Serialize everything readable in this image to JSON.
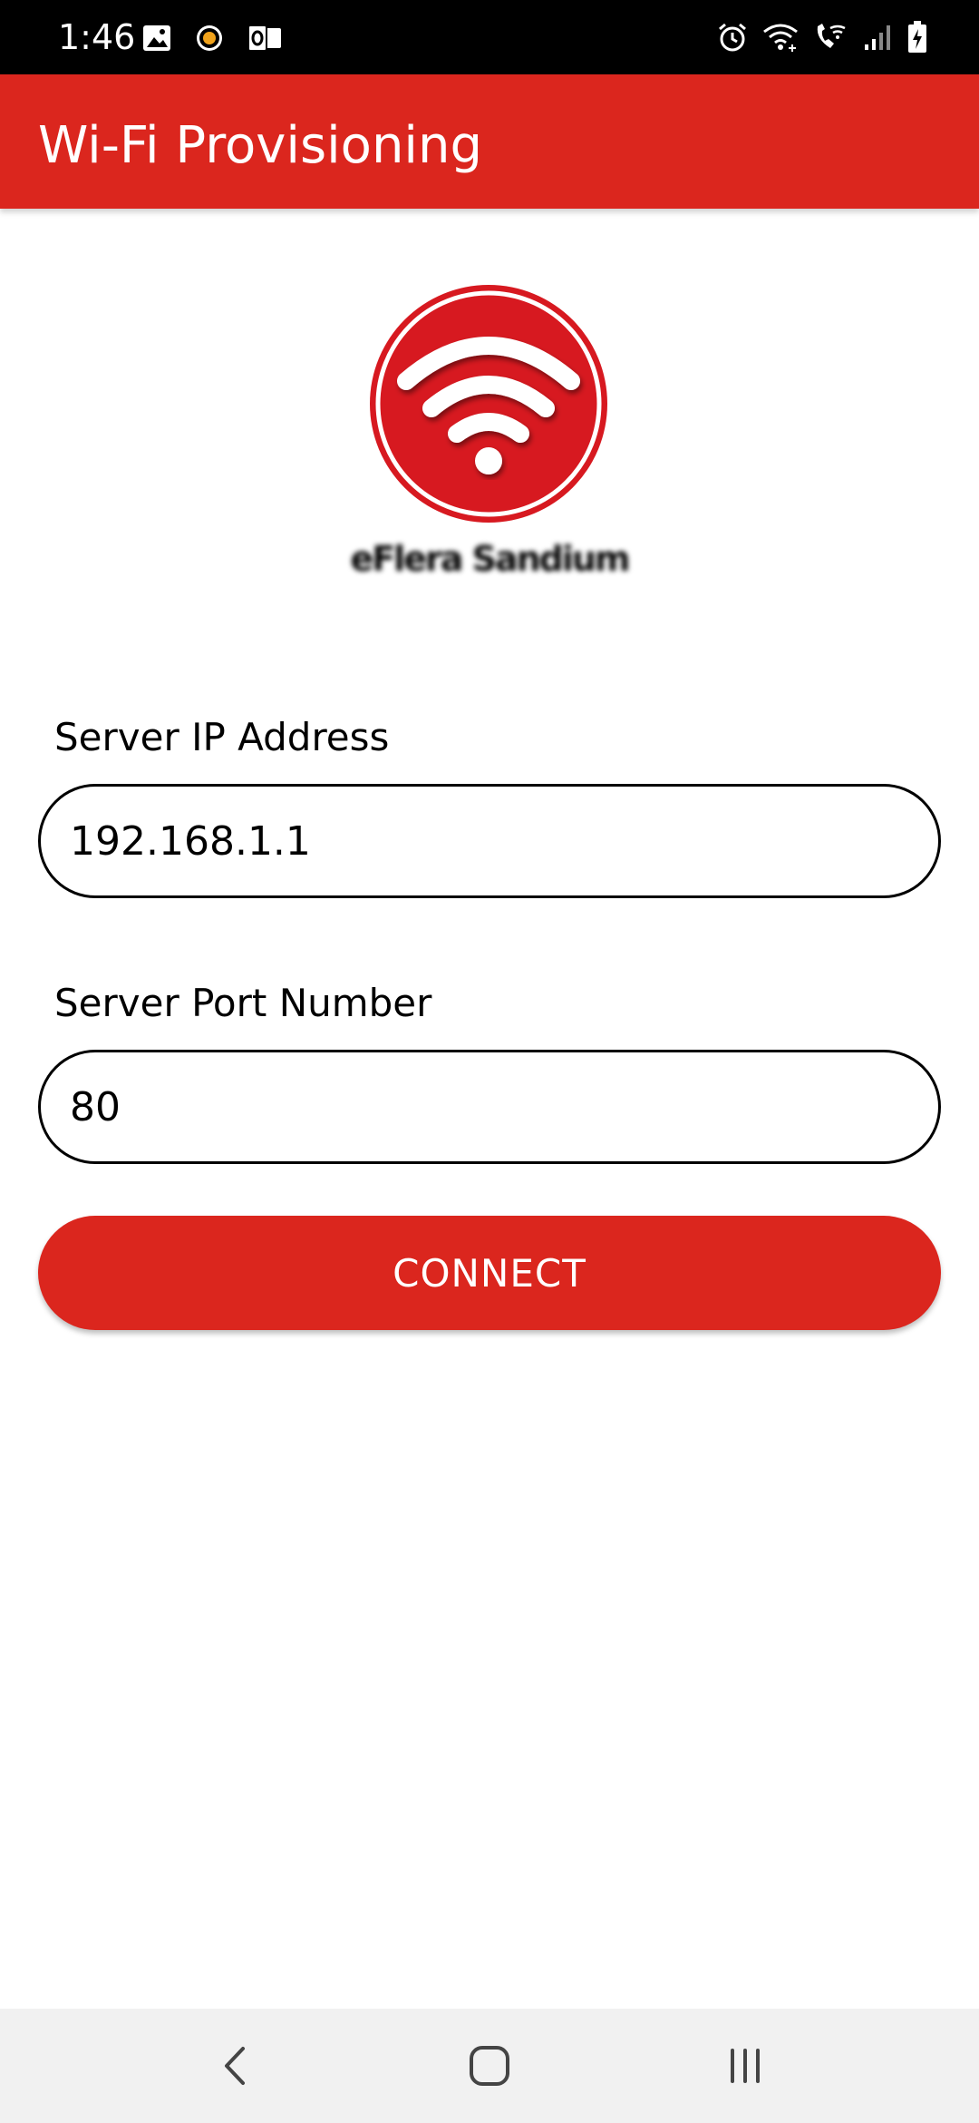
{
  "status_bar": {
    "time": "1:46",
    "left_icons": [
      "image-icon",
      "circle-app-icon",
      "outlook-icon"
    ],
    "right_icons": [
      "alarm-icon",
      "wifi-icon",
      "wifi-calling-icon",
      "signal-icon",
      "battery-icon"
    ]
  },
  "app_bar": {
    "title": "Wi-Fi Provisioning",
    "color": "#db261e"
  },
  "logo": {
    "icon": "wifi-logo-icon",
    "caption": "eFlera Sandium"
  },
  "form": {
    "ip_label": "Server IP Address",
    "ip_value": "192.168.1.1",
    "port_label": "Server Port Number",
    "port_value": "80",
    "connect_label": "CONNECT"
  },
  "nav_bar": {
    "buttons": [
      "back-icon",
      "home-icon",
      "recents-icon"
    ]
  }
}
